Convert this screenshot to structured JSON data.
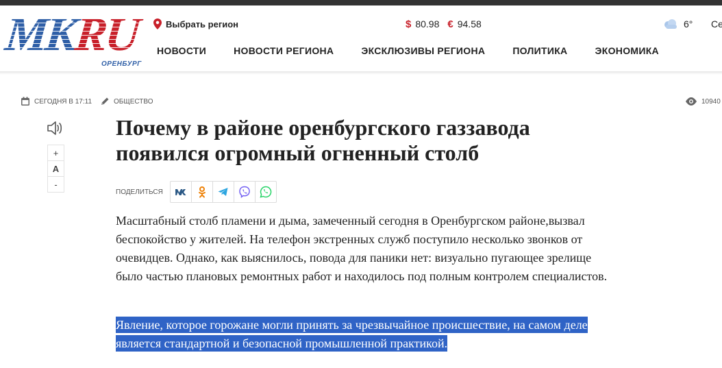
{
  "logo": {
    "left": "MK",
    "right": "RU",
    "city": "ОРЕНБУРГ"
  },
  "header": {
    "region_label": "Выбрать регион",
    "currency": [
      {
        "sign": "$",
        "value": "80.98"
      },
      {
        "sign": "€",
        "value": "94.58"
      }
    ],
    "weather": {
      "temp": "6°",
      "day": "Се"
    }
  },
  "nav": {
    "items": [
      "НОВОСТИ",
      "НОВОСТИ РЕГИОНА",
      "ЭКСКЛЮЗИВЫ РЕГИОНА",
      "ПОЛИТИКА",
      "ЭКОНОМИКА"
    ]
  },
  "meta": {
    "date": "СЕГОДНЯ В 17:11",
    "rubric": "ОБЩЕСТВО",
    "views": "10940"
  },
  "tools": {
    "increase": "+",
    "font": "A",
    "decrease": "-"
  },
  "article": {
    "title": "Почему в районе оренбургского газзавода появился огромный огненный столб",
    "share_label": "ПОДЕЛИТЬСЯ",
    "p1": "Масштабный столб пламени и дыма, замеченный сегодня в Оренбургском районе,вызвал беспокойство у жителей. На телефон экстренных служб поступило несколько звонков от очевидцев. Однако, как выяснилось, повода для паники нет: визуально пугающее зрелище было частью плановых ремонтных работ и находилось под полным контролем специалистов.",
    "p2": "Явление, которое горожане могли принять за чрезвычайное происшествие, на самом деле является стандартной и безопасной промышленной практикой."
  },
  "colors": {
    "brand_blue": "#2f5fa7",
    "brand_red": "#c8202a",
    "highlight": "#2f63c6",
    "topbar": "#333333"
  },
  "icons": [
    "pin-icon",
    "cloud-icon",
    "calendar-icon",
    "pencil-icon",
    "eye-icon",
    "speaker-icon",
    "vk-icon",
    "odnoklassniki-icon",
    "telegram-icon",
    "viber-icon",
    "whatsapp-icon"
  ]
}
